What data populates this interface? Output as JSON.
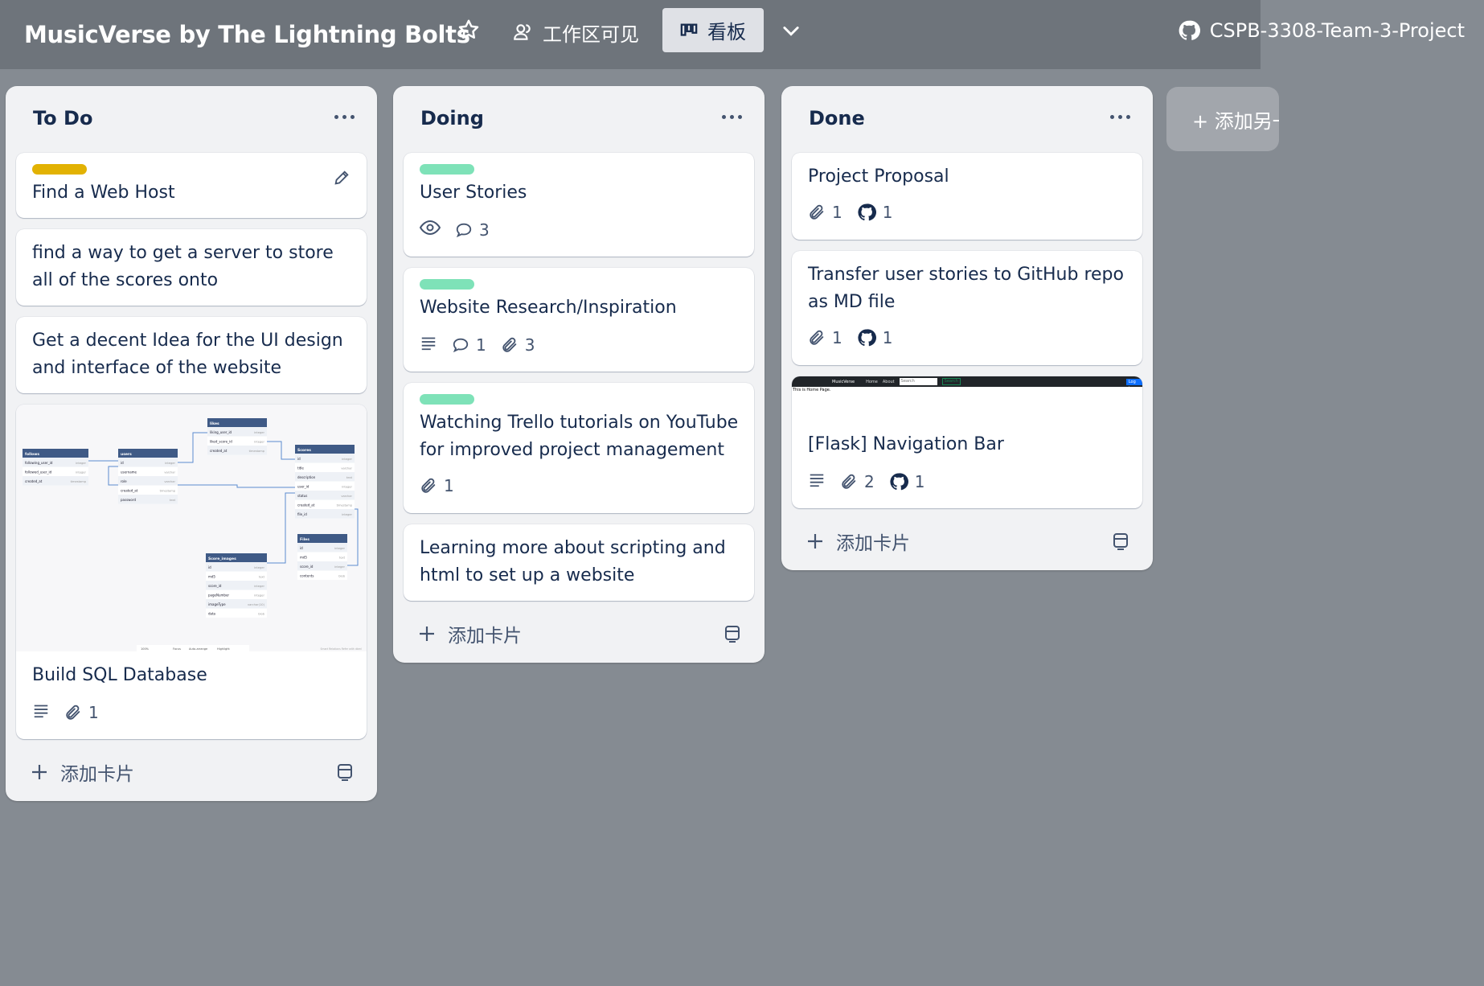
{
  "header": {
    "board_title": "MusicVerse by The Lightning Bolts",
    "visibility_label": "工作区可见",
    "view_label": "看板",
    "repo_label": "CSPB-3308-Team-3-Project"
  },
  "lists": [
    {
      "title": "To Do",
      "add_card_label": "添加卡片",
      "cards": [
        {
          "title": "Find a Web Host",
          "label_color": "#e2b203"
        },
        {
          "title": "find a way to get a server to store all of the scores onto"
        },
        {
          "title": "Get a decent Idea for the UI design and interface of the website"
        },
        {
          "title": "Build SQL Database",
          "badges": {
            "attachments": "1"
          }
        }
      ]
    },
    {
      "title": "Doing",
      "add_card_label": "添加卡片",
      "cards": [
        {
          "title": "User Stories",
          "label_color": "#7ee2b8",
          "badges": {
            "comments": "3"
          }
        },
        {
          "title": "Website Research/Inspiration",
          "label_color": "#7ee2b8",
          "badges": {
            "comments": "1",
            "attachments": "3"
          }
        },
        {
          "title": "Watching Trello tutorials on YouTube for improved project management",
          "label_color": "#7ee2b8",
          "badges": {
            "attachments": "1"
          }
        },
        {
          "title": "Learning more about scripting and html to set up a website"
        }
      ]
    },
    {
      "title": "Done",
      "add_card_label": "添加卡片",
      "cards": [
        {
          "title": "Project Proposal",
          "badges": {
            "attachments": "1",
            "github": "1"
          }
        },
        {
          "title": "Transfer user stories to GitHub repo as MD file",
          "badges": {
            "attachments": "1",
            "github": "1"
          }
        },
        {
          "title": "[Flask] Navigation Bar",
          "badges": {
            "attachments": "2",
            "github": "1"
          }
        }
      ]
    }
  ],
  "add_list_label": "+ 添加另一个列表",
  "db_diagram": {
    "tables": [
      {
        "name": "follows",
        "rows": [
          [
            "following_user_id",
            "integer"
          ],
          [
            "followed_user_id",
            "integer"
          ],
          [
            "created_at",
            "timestamp"
          ]
        ]
      },
      {
        "name": "users",
        "rows": [
          [
            "id",
            "integer"
          ],
          [
            "username",
            "varchar"
          ],
          [
            "role",
            "varchar"
          ],
          [
            "created_at",
            "timestamp"
          ],
          [
            "password",
            "text"
          ]
        ]
      },
      {
        "name": "likes",
        "rows": [
          [
            "liking_user_id",
            "integer"
          ],
          [
            "liked_score_id",
            "integer"
          ],
          [
            "created_at",
            "timestamp"
          ]
        ]
      },
      {
        "name": "Scores",
        "rows": [
          [
            "id",
            "integer"
          ],
          [
            "title",
            "varchar"
          ],
          [
            "description",
            "text"
          ],
          [
            "user_id",
            "integer"
          ],
          [
            "status",
            "varchar"
          ],
          [
            "created_at",
            "timestamp"
          ],
          [
            "file_id",
            "integer"
          ]
        ]
      },
      {
        "name": "Score_images",
        "rows": [
          [
            "id",
            "integer"
          ],
          [
            "md5",
            "text"
          ],
          [
            "score_id",
            "integer"
          ],
          [
            "pageNumber",
            "integer"
          ],
          [
            "imageType",
            "varchar(10)"
          ],
          [
            "data",
            "blob"
          ]
        ]
      },
      {
        "name": "Files",
        "rows": [
          [
            "id",
            "integer"
          ],
          [
            "md5",
            "text"
          ],
          [
            "score_id",
            "integer"
          ],
          [
            "contents",
            "blob"
          ]
        ]
      }
    ],
    "footer": {
      "zoom": "100%",
      "focus": "Focus",
      "auto": "Auto-arrange",
      "highlight": "Highlight",
      "credit": "Smart Relations Refer with dbml"
    }
  },
  "nav_preview": {
    "brand": "MusicVerse",
    "links": [
      "Home",
      "About"
    ],
    "search_placeholder": "Search",
    "search_button": "Search",
    "login_button": "Log in",
    "body_text": "This is Home Page."
  },
  "colors": {
    "green_label": "#7ee2b8",
    "yellow_label": "#e2b203",
    "header_bg": "#6e747b",
    "board_bg": "#858b92"
  }
}
